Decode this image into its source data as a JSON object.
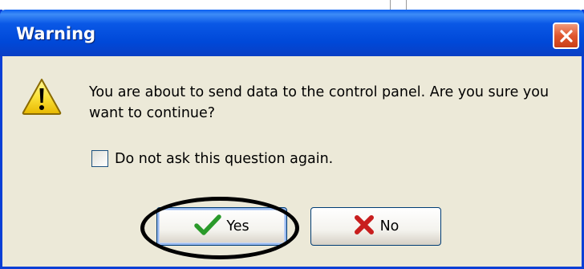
{
  "dialog": {
    "title": "Warning",
    "message": "You are about to send data to the control panel. Are you sure you want to continue?",
    "checkbox_label": "Do not ask this question again.",
    "checkbox_checked": false,
    "yes_label": "Yes",
    "no_label": "No"
  },
  "icons": {
    "close": "close-icon",
    "warning": "warning-icon",
    "yes": "checkmark-icon",
    "no": "x-icon"
  },
  "colors": {
    "title_bar": "#0054e3",
    "dialog_bg": "#ece9d8",
    "close_button": "#e0562e",
    "checkmark": "#2a9a2a",
    "x_mark": "#c81e1e",
    "highlight_ellipse": "#000000"
  }
}
